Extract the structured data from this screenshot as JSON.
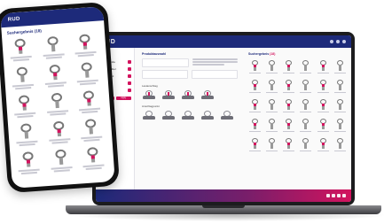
{
  "brand": {
    "logo_text": "RUD",
    "primary_color": "#1d2a7a",
    "accent_color": "#d3135e"
  },
  "laptop": {
    "sidebar": {
      "title": "Filters",
      "items": [
        {
          "label": "Produktfamilie"
        },
        {
          "label": "Anschlagmittel"
        },
        {
          "label": "Tragfähigkeit"
        },
        {
          "label": "Gewindeart"
        },
        {
          "label": "Zubehör"
        }
      ],
      "buttons": [
        "Reset",
        "Apply"
      ]
    },
    "config": {
      "title": "Produktauswahl",
      "section1": "Lastanschlag",
      "section2": "Anschlagpunkt"
    },
    "results": {
      "title": "Suchergebnis",
      "count_label": "(18)"
    }
  },
  "phone": {
    "title": "Suchergebnis (18)"
  }
}
